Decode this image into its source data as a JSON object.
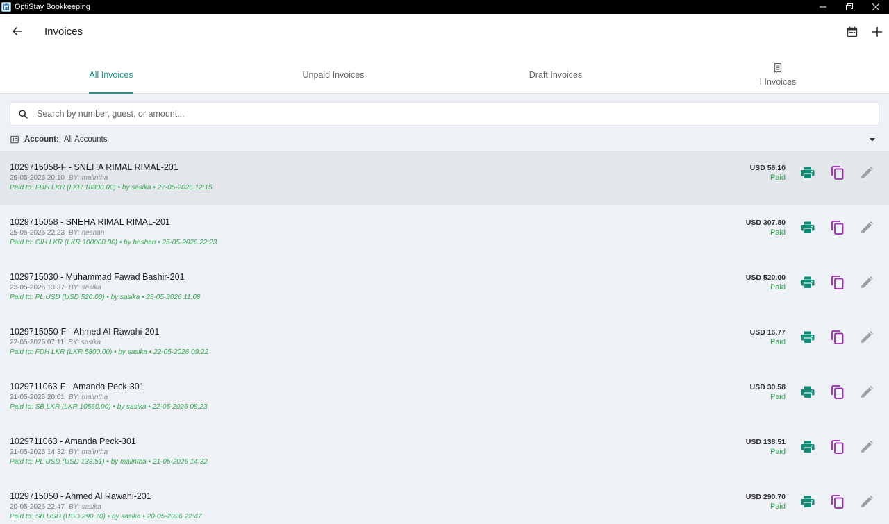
{
  "window": {
    "title": "OptiStay Bookkeeping",
    "logo_icon": "hotel-logo-icon",
    "controls": [
      "minimize-icon",
      "restore-icon",
      "close-icon"
    ]
  },
  "header": {
    "title": "Invoices",
    "back_icon": "arrow-left-icon",
    "calendar_icon": "calendar-icon",
    "add_icon": "plus-icon"
  },
  "tabs": [
    {
      "label": "All Invoices",
      "active": true
    },
    {
      "label": "Unpaid Invoices",
      "active": false
    },
    {
      "label": "Draft Invoices",
      "active": false
    },
    {
      "label": "I Invoices",
      "active": false,
      "icon": "receipt-icon"
    }
  ],
  "search": {
    "placeholder": "Search by number, guest, or amount...",
    "value": ""
  },
  "account_filter": {
    "label": "Account:",
    "value": "All Accounts"
  },
  "colors": {
    "accent": "#1a9a8a",
    "paid_green": "#34a853",
    "print_icon": "#0f8a75",
    "copy_icon": "#9c27b0",
    "edit_icon": "#9e9e9e"
  },
  "invoices": [
    {
      "title": "1029715058-F - SNEHA RIMAL RIMAL-201",
      "date": "26-05-2026 20:10",
      "by": "BY: malintha",
      "paid": "Paid to: FDH LKR (LKR 18300.00) • by sasika • 27-05-2026 12:15",
      "amount": "USD 56.10",
      "status": "Paid"
    },
    {
      "title": "1029715058 - SNEHA RIMAL RIMAL-201",
      "date": "25-05-2026 22:23",
      "by": "BY: heshan",
      "paid": "Paid to: CIH LKR (LKR 100000.00) • by heshan • 25-05-2026 22:23",
      "amount": "USD 307.80",
      "status": "Paid"
    },
    {
      "title": "1029715030 - Muhammad Fawad Bashir-201",
      "date": "23-05-2026 13:37",
      "by": "BY: sasika",
      "paid": "Paid to: PL USD (USD 520.00) • by sasika • 25-05-2026 11:08",
      "amount": "USD 520.00",
      "status": "Paid"
    },
    {
      "title": "1029715050-F - Ahmed Al Rawahi-201",
      "date": "22-05-2026 07:11",
      "by": "BY: sasika",
      "paid": "Paid to: FDH LKR (LKR 5800.00) • by sasika • 22-05-2026 09:22",
      "amount": "USD 16.77",
      "status": "Paid"
    },
    {
      "title": "1029711063-F - Amanda Peck-301",
      "date": "21-05-2026 20:01",
      "by": "BY: malintha",
      "paid": "Paid to: SB LKR (LKR 10560.00) • by sasika • 22-05-2026 08:23",
      "amount": "USD 30.58",
      "status": "Paid"
    },
    {
      "title": "1029711063 - Amanda Peck-301",
      "date": "21-05-2026 14:32",
      "by": "BY: malintha",
      "paid": "Paid to: PL USD (USD 138.51) • by malintha • 21-05-2026 14:32",
      "amount": "USD 138.51",
      "status": "Paid"
    },
    {
      "title": "1029715050 - Ahmed Al Rawahi-201",
      "date": "20-05-2026 22:47",
      "by": "BY: sasika",
      "paid": "Paid to: SB USD (USD 290.70) • by sasika • 20-05-2026 22:47",
      "amount": "USD 290.70",
      "status": "Paid"
    }
  ],
  "row_actions": [
    "print-icon",
    "copy-icon",
    "edit-icon"
  ]
}
